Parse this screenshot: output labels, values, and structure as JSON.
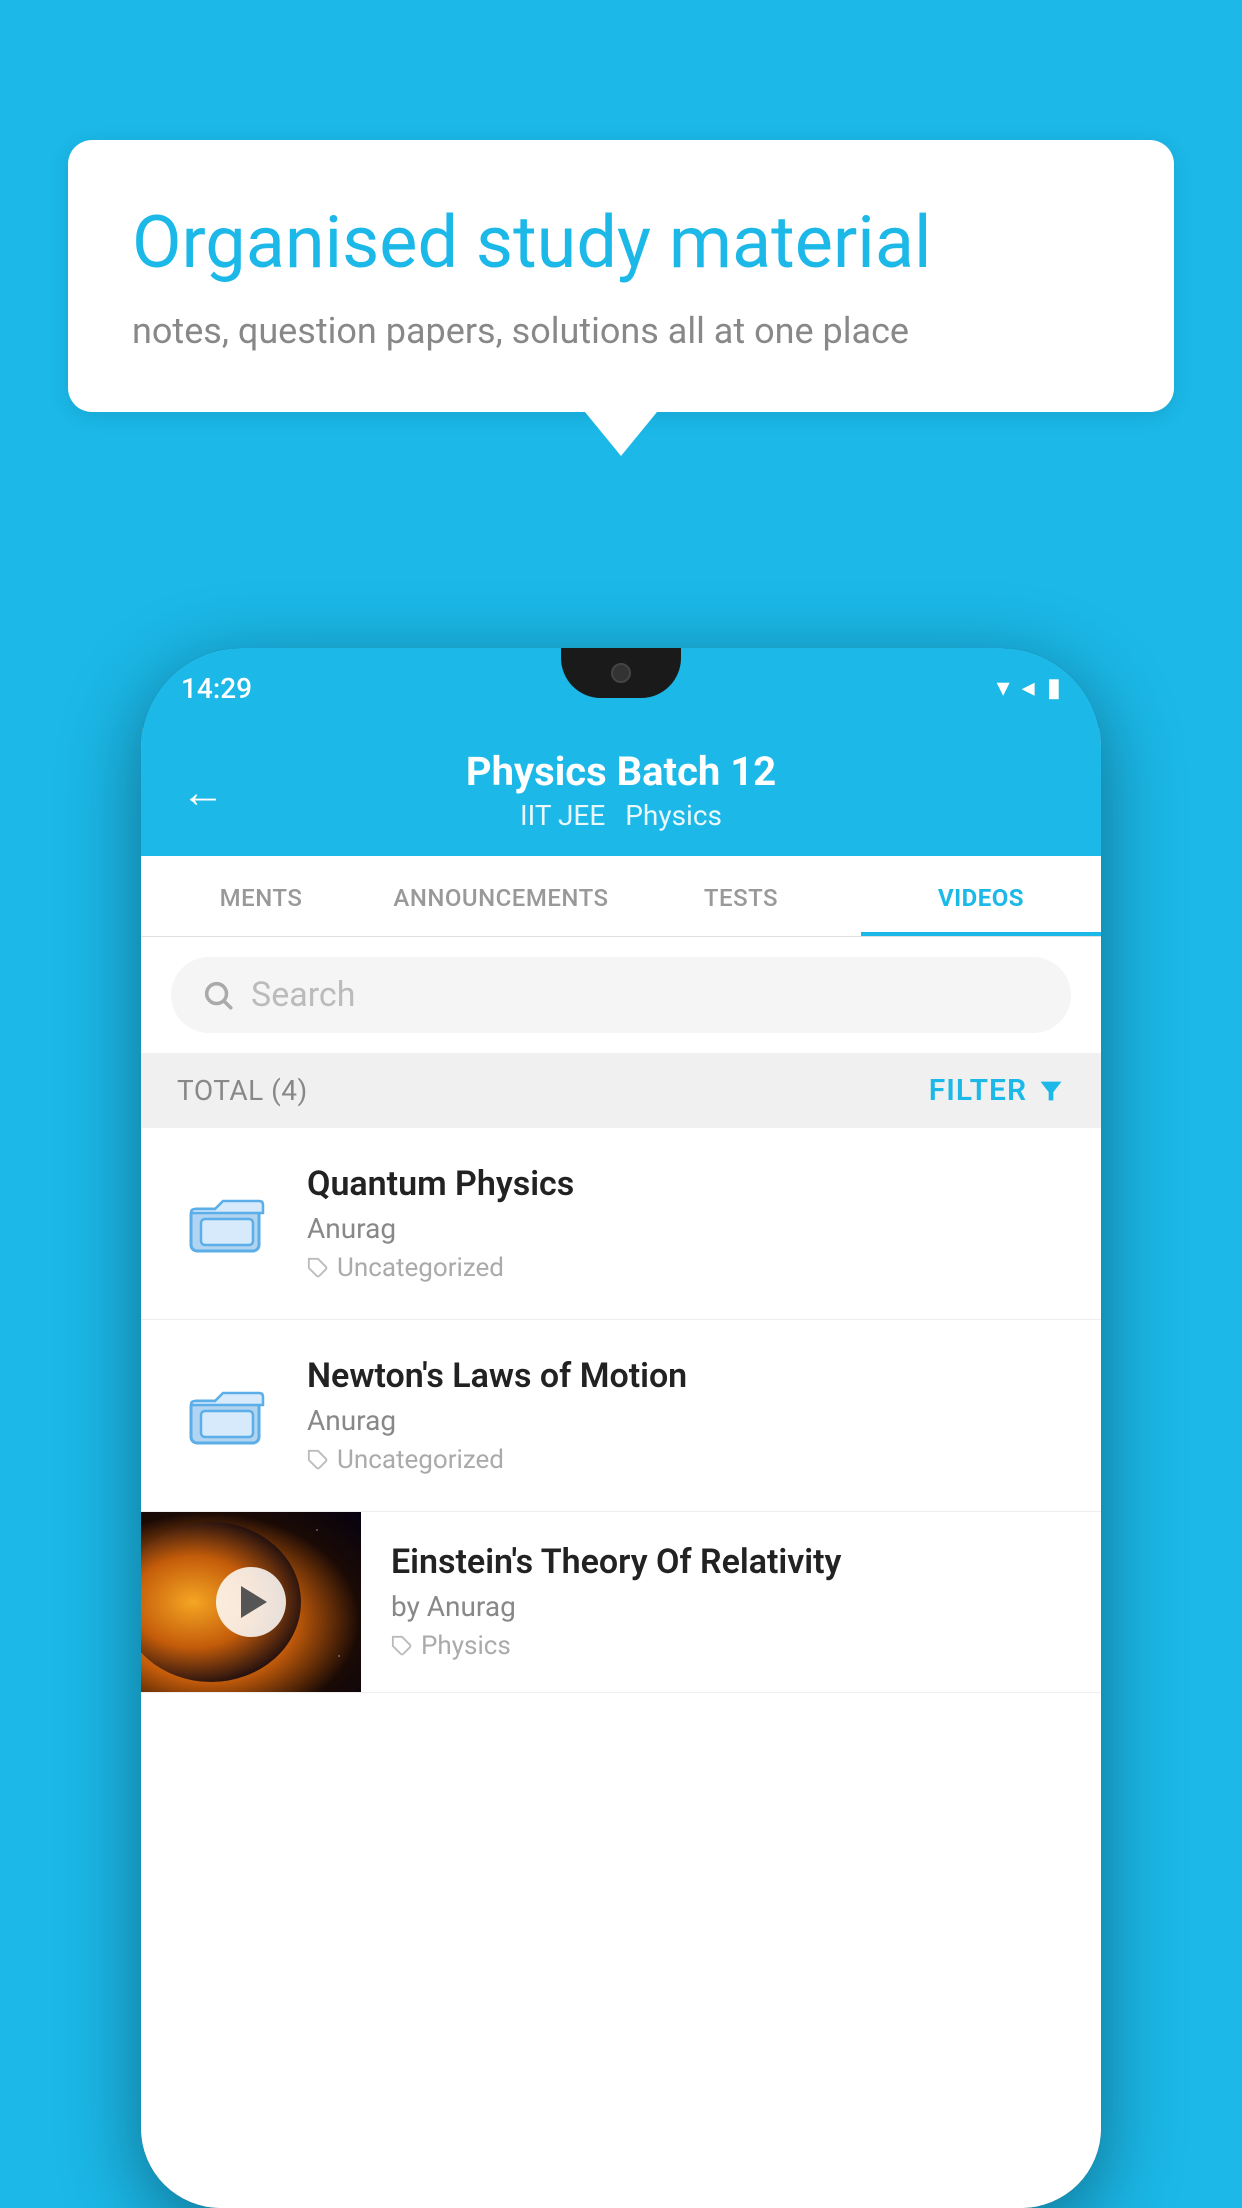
{
  "background_color": "#1BB8E8",
  "bubble": {
    "title": "Organised study material",
    "subtitle": "notes, question papers, solutions all at one place"
  },
  "phone": {
    "status_bar": {
      "time": "14:29"
    },
    "header": {
      "back_label": "←",
      "title": "Physics Batch 12",
      "subtitle1": "IIT JEE",
      "subtitle2": "Physics"
    },
    "tabs": [
      {
        "label": "MENTS",
        "active": false
      },
      {
        "label": "ANNOUNCEMENTS",
        "active": false
      },
      {
        "label": "TESTS",
        "active": false
      },
      {
        "label": "VIDEOS",
        "active": true
      }
    ],
    "search": {
      "placeholder": "Search"
    },
    "filter_bar": {
      "total": "TOTAL (4)",
      "filter_label": "FILTER"
    },
    "videos": [
      {
        "title": "Quantum Physics",
        "author": "Anurag",
        "tag": "Uncategorized",
        "has_thumb": false
      },
      {
        "title": "Newton's Laws of Motion",
        "author": "Anurag",
        "tag": "Uncategorized",
        "has_thumb": false
      },
      {
        "title": "Einstein's Theory Of Relativity",
        "author": "by Anurag",
        "tag": "Physics",
        "has_thumb": true
      }
    ]
  }
}
